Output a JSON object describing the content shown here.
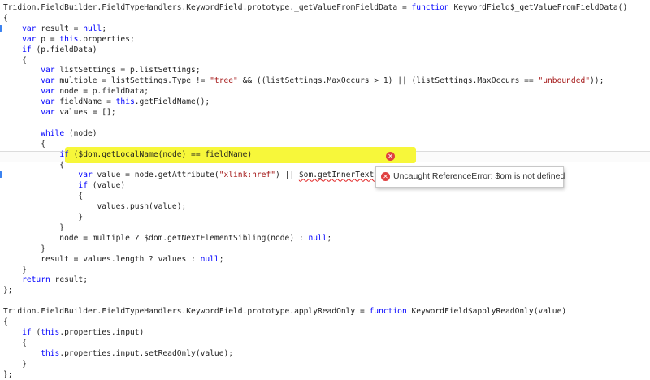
{
  "editor": {
    "lines": [
      [
        {
          "t": "pl",
          "v": "Tridion.FieldBuilder.FieldTypeHandlers.KeywordField.prototype._getValueFromFieldData = "
        },
        {
          "t": "kw",
          "v": "function"
        },
        {
          "t": "pl",
          "v": " KeywordField$_getValueFromFieldData()"
        }
      ],
      [
        {
          "t": "pl",
          "v": "{"
        }
      ],
      [
        {
          "t": "pl",
          "v": "    "
        },
        {
          "t": "kw",
          "v": "var"
        },
        {
          "t": "pl",
          "v": " result = "
        },
        {
          "t": "kw",
          "v": "null"
        },
        {
          "t": "pl",
          "v": ";"
        }
      ],
      [
        {
          "t": "pl",
          "v": "    "
        },
        {
          "t": "kw",
          "v": "var"
        },
        {
          "t": "pl",
          "v": " p = "
        },
        {
          "t": "kw",
          "v": "this"
        },
        {
          "t": "pl",
          "v": ".properties;"
        }
      ],
      [
        {
          "t": "pl",
          "v": "    "
        },
        {
          "t": "kw",
          "v": "if"
        },
        {
          "t": "pl",
          "v": " (p.fieldData)"
        }
      ],
      [
        {
          "t": "pl",
          "v": "    {"
        }
      ],
      [
        {
          "t": "pl",
          "v": "        "
        },
        {
          "t": "kw",
          "v": "var"
        },
        {
          "t": "pl",
          "v": " listSettings = p.listSettings;"
        }
      ],
      [
        {
          "t": "pl",
          "v": "        "
        },
        {
          "t": "kw",
          "v": "var"
        },
        {
          "t": "pl",
          "v": " multiple = listSettings.Type != "
        },
        {
          "t": "str",
          "v": "\"tree\""
        },
        {
          "t": "pl",
          "v": " && ((listSettings.MaxOccurs > 1) || (listSettings.MaxOccurs == "
        },
        {
          "t": "str",
          "v": "\"unbounded\""
        },
        {
          "t": "pl",
          "v": "));"
        }
      ],
      [
        {
          "t": "pl",
          "v": "        "
        },
        {
          "t": "kw",
          "v": "var"
        },
        {
          "t": "pl",
          "v": " node = p.fieldData;"
        }
      ],
      [
        {
          "t": "pl",
          "v": "        "
        },
        {
          "t": "kw",
          "v": "var"
        },
        {
          "t": "pl",
          "v": " fieldName = "
        },
        {
          "t": "kw",
          "v": "this"
        },
        {
          "t": "pl",
          "v": ".getFieldName();"
        }
      ],
      [
        {
          "t": "pl",
          "v": "        "
        },
        {
          "t": "kw",
          "v": "var"
        },
        {
          "t": "pl",
          "v": " values = [];"
        }
      ],
      [],
      [
        {
          "t": "pl",
          "v": "        "
        },
        {
          "t": "kw",
          "v": "while"
        },
        {
          "t": "pl",
          "v": " (node)"
        }
      ],
      [
        {
          "t": "pl",
          "v": "        {"
        }
      ],
      [
        {
          "t": "pl",
          "v": "            "
        },
        {
          "t": "kw",
          "v": "if"
        },
        {
          "t": "pl",
          "v": " ($dom.getLocalName(node) == fieldName)"
        }
      ],
      [
        {
          "t": "pl",
          "v": "            {"
        }
      ],
      [
        {
          "t": "pl",
          "v": "                "
        },
        {
          "t": "kw",
          "v": "var"
        },
        {
          "t": "pl",
          "v": " value = node.getAttribute("
        },
        {
          "t": "str",
          "v": "\"xlink:href\""
        },
        {
          "t": "pl",
          "v": ") || "
        },
        {
          "t": "err",
          "v": "$om.getInnerText(node)"
        },
        {
          "t": "pl",
          "v": ";"
        }
      ],
      [
        {
          "t": "pl",
          "v": "                "
        },
        {
          "t": "kw",
          "v": "if"
        },
        {
          "t": "pl",
          "v": " (value)"
        }
      ],
      [
        {
          "t": "pl",
          "v": "                {"
        }
      ],
      [
        {
          "t": "pl",
          "v": "                    values.push(value);"
        }
      ],
      [
        {
          "t": "pl",
          "v": "                }"
        }
      ],
      [
        {
          "t": "pl",
          "v": "            }"
        }
      ],
      [
        {
          "t": "pl",
          "v": "            node = multiple ? $dom.getNextElementSibling(node) : "
        },
        {
          "t": "kw",
          "v": "null"
        },
        {
          "t": "pl",
          "v": ";"
        }
      ],
      [
        {
          "t": "pl",
          "v": "        }"
        }
      ],
      [
        {
          "t": "pl",
          "v": "        result = values.length ? values : "
        },
        {
          "t": "kw",
          "v": "null"
        },
        {
          "t": "pl",
          "v": ";"
        }
      ],
      [
        {
          "t": "pl",
          "v": "    }"
        }
      ],
      [
        {
          "t": "pl",
          "v": "    "
        },
        {
          "t": "kw",
          "v": "return"
        },
        {
          "t": "pl",
          "v": " result;"
        }
      ],
      [
        {
          "t": "pl",
          "v": "};"
        }
      ],
      [],
      [
        {
          "t": "pl",
          "v": "Tridion.FieldBuilder.FieldTypeHandlers.KeywordField.prototype.applyReadOnly = "
        },
        {
          "t": "kw",
          "v": "function"
        },
        {
          "t": "pl",
          "v": " KeywordField$applyReadOnly(value)"
        }
      ],
      [
        {
          "t": "pl",
          "v": "{"
        }
      ],
      [
        {
          "t": "pl",
          "v": "    "
        },
        {
          "t": "kw",
          "v": "if"
        },
        {
          "t": "pl",
          "v": " ("
        },
        {
          "t": "kw",
          "v": "this"
        },
        {
          "t": "pl",
          "v": ".properties.input)"
        }
      ],
      [
        {
          "t": "pl",
          "v": "    {"
        }
      ],
      [
        {
          "t": "pl",
          "v": "        "
        },
        {
          "t": "kw",
          "v": "this"
        },
        {
          "t": "pl",
          "v": ".properties.input.setReadOnly(value);"
        }
      ],
      [
        {
          "t": "pl",
          "v": "    }"
        }
      ],
      [
        {
          "t": "pl",
          "v": "};"
        }
      ]
    ],
    "breakpoint_lines": [
      2,
      16
    ],
    "error_line": 16
  },
  "error_tooltip": {
    "icon": "error-circle-icon",
    "message": "Uncaught ReferenceError: $om is not defined"
  },
  "colors": {
    "keyword": "#0000ff",
    "string": "#a31515",
    "highlight": "#f7f73a",
    "error": "#e04040",
    "breakpoint": "#3b82f0"
  }
}
